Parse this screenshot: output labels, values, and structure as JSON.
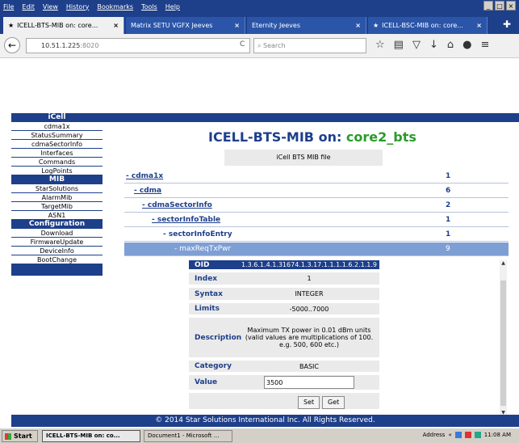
{
  "browser": {
    "menu": [
      "File",
      "Edit",
      "View",
      "History",
      "Bookmarks",
      "Tools",
      "Help"
    ],
    "tabs": [
      {
        "label": "ICELL-BTS-MIB on: core..."
      },
      {
        "label": "Matrix SETU VGFX Jeeves"
      },
      {
        "label": "Eternity Jeeves"
      },
      {
        "label": "ICELL-BSC-MIB on: core..."
      }
    ],
    "url": "10.51.1.225",
    "url_port": ":8020",
    "search_placeholder": "Search"
  },
  "sidebar": {
    "sections": [
      {
        "head": "iCell",
        "items": [
          "cdma1x",
          "StatusSummary",
          "cdmaSectorInfo",
          "Interfaces",
          "Commands",
          "LogPoints"
        ]
      },
      {
        "head": "MIB",
        "items": [
          "StarSolutions",
          "AlarmMib",
          "TargetMib",
          "ASN1"
        ]
      },
      {
        "head": "Configuration",
        "items": [
          "Download",
          "FirmwareUpdate",
          "DeviceInfo",
          "BootChange"
        ]
      }
    ]
  },
  "main": {
    "title_prefix": "ICELL-BTS-MIB on: ",
    "title_host": "core2_bts",
    "subtitle": "iCell BTS MIB file",
    "tree": [
      {
        "label": "- cdma1x",
        "count": "1"
      },
      {
        "label": "- cdma",
        "count": "6"
      },
      {
        "label": "- cdmaSectorInfo",
        "count": "2"
      },
      {
        "label": "- sectorInfoTable",
        "count": "1"
      },
      {
        "label": "- sectorInfoEntry",
        "count": "1"
      },
      {
        "label": "- maxReqTxPwr",
        "count": "9"
      }
    ],
    "detail": {
      "oid_label": "OID",
      "oid_value": "1.3.6.1.4.1.31674.1.3.17.1.1.1.1.6.2.1.1.9",
      "index_label": "Index",
      "index_value": "1",
      "syntax_label": "Syntax",
      "syntax_value": "INTEGER",
      "limits_label": "Limits",
      "limits_value": "-5000..7000",
      "description_label": "Description",
      "description_value": "Maximum TX power in 0.01 dBm units (valid values are multiplications of 100. e.g. 500, 600 etc.)",
      "category_label": "Category",
      "category_value": "BASIC",
      "value_label": "Value",
      "value_input": "3500",
      "set_label": "Set",
      "get_label": "Get"
    },
    "footer": "© 2014 Star Solutions International Inc. All Rights Reserved."
  },
  "taskbar": {
    "start_label": "Start",
    "tasks": [
      "ICELL-BTS-MIB on: co...",
      "Document1 - Microsoft ..."
    ],
    "address_label": "Address",
    "clock": "11:08 AM"
  }
}
